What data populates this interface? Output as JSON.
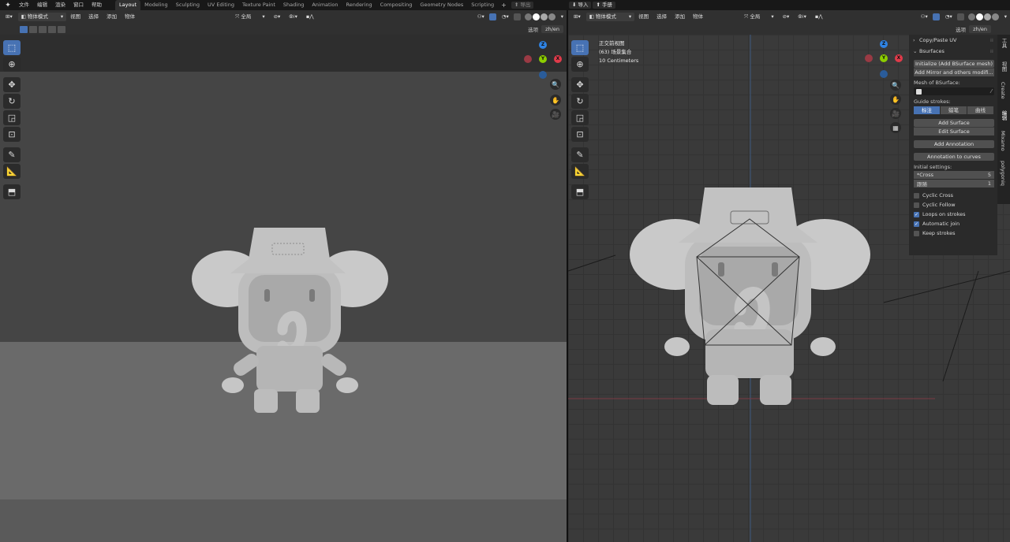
{
  "topbar": {
    "menus": [
      "文件",
      "编辑",
      "渲染",
      "窗口",
      "帮助"
    ],
    "workspaces": [
      "Layout",
      "Modeling",
      "Sculpting",
      "UV Editing",
      "Texture Paint",
      "Shading",
      "Animation",
      "Rendering",
      "Compositing",
      "Geometry Nodes",
      "Scripting"
    ],
    "active_workspace": "Layout",
    "plus": "+",
    "export_label": "导出",
    "import_label": "导入",
    "manual_label": "手册"
  },
  "left_editor": {
    "mode": "物体模式",
    "menus": [
      "视图",
      "选择",
      "添加",
      "物体"
    ],
    "transform_orientation": "全局",
    "options_label": "选项",
    "lang_label": "zh/en"
  },
  "right_editor": {
    "mode": "物体模式",
    "menus": [
      "视图",
      "选择",
      "添加",
      "物体"
    ],
    "transform_orientation": "全局",
    "options_label": "选项",
    "lang_label": "zh/en",
    "overlay": {
      "view_name": "正交前视图",
      "collection": "(63) 场景集合",
      "scale": "10 Centimeters"
    }
  },
  "gizmo": {
    "x": "X",
    "y": "Y",
    "z": "Z"
  },
  "npanel": {
    "copy_paste_uv": "Copy/Paste UV",
    "bsurfaces": "Bsurfaces",
    "init_btn": "Initialize (Add BSurface mesh)",
    "mirror_btn": "Add Mirror and others modifi...",
    "mesh_label": "Mesh of BSurface:",
    "guide_label": "Guide strokes:",
    "guide_options": [
      "标注",
      "蜡笔",
      "曲线"
    ],
    "add_surface": "Add Surface",
    "edit_surface": "Edit Surface",
    "add_annotation": "Add Annotation",
    "annotation_to_curves": "Annotation to curves",
    "initial_settings": "Initial settings:",
    "cross_label": "*Cross",
    "cross_value": "5",
    "follow_label": "跟随",
    "follow_value": "1",
    "checks": [
      {
        "label": "Cyclic Cross",
        "on": false
      },
      {
        "label": "Cyclic Follow",
        "on": false
      },
      {
        "label": "Loops on strokes",
        "on": true
      },
      {
        "label": "Automatic join",
        "on": true
      },
      {
        "label": "Keep strokes",
        "on": false
      }
    ],
    "vertical_tabs": [
      "工具",
      "视图",
      "Create",
      "编辑",
      "Mixamo",
      "polygoniq"
    ]
  },
  "colors": {
    "accent": "#4772b3",
    "axis_x": "#e03b4a",
    "axis_y": "#8ccd00",
    "axis_z": "#2f83e3"
  }
}
